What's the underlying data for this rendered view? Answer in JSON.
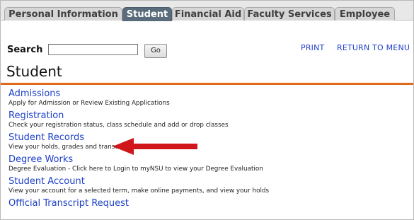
{
  "tabs": [
    {
      "label": "Personal Information",
      "active": false
    },
    {
      "label": "Student",
      "active": true
    },
    {
      "label": "Financial Aid",
      "active": false
    },
    {
      "label": "Faculty Services",
      "active": false
    },
    {
      "label": "Employee",
      "active": false
    }
  ],
  "search": {
    "label": "Search",
    "value": "",
    "go_label": "Go"
  },
  "top_links": {
    "print": "PRINT",
    "return": "RETURN TO MENU"
  },
  "page_title": "Student",
  "menu": [
    {
      "label": "Admissions",
      "description": "Apply for Admission or Review Existing Applications"
    },
    {
      "label": "Registration",
      "description": "Check your registration status, class schedule and add or drop classes"
    },
    {
      "label": "Student Records",
      "description": "View your holds, grades and transcripts"
    },
    {
      "label": "Degree Works",
      "description": "Degree Evaluation - Click here to Login to myNSU to view your Degree Evaluation"
    },
    {
      "label": "Student Account",
      "description": "View your account for a selected term, make online payments, and view your holds"
    },
    {
      "label": "Official Transcript Request",
      "description": ""
    }
  ],
  "colors": {
    "link": "#1f41c8",
    "accent_rule": "#e06a1a",
    "active_tab": "#5a6b7b",
    "annotation_arrow": "#d0151b"
  }
}
